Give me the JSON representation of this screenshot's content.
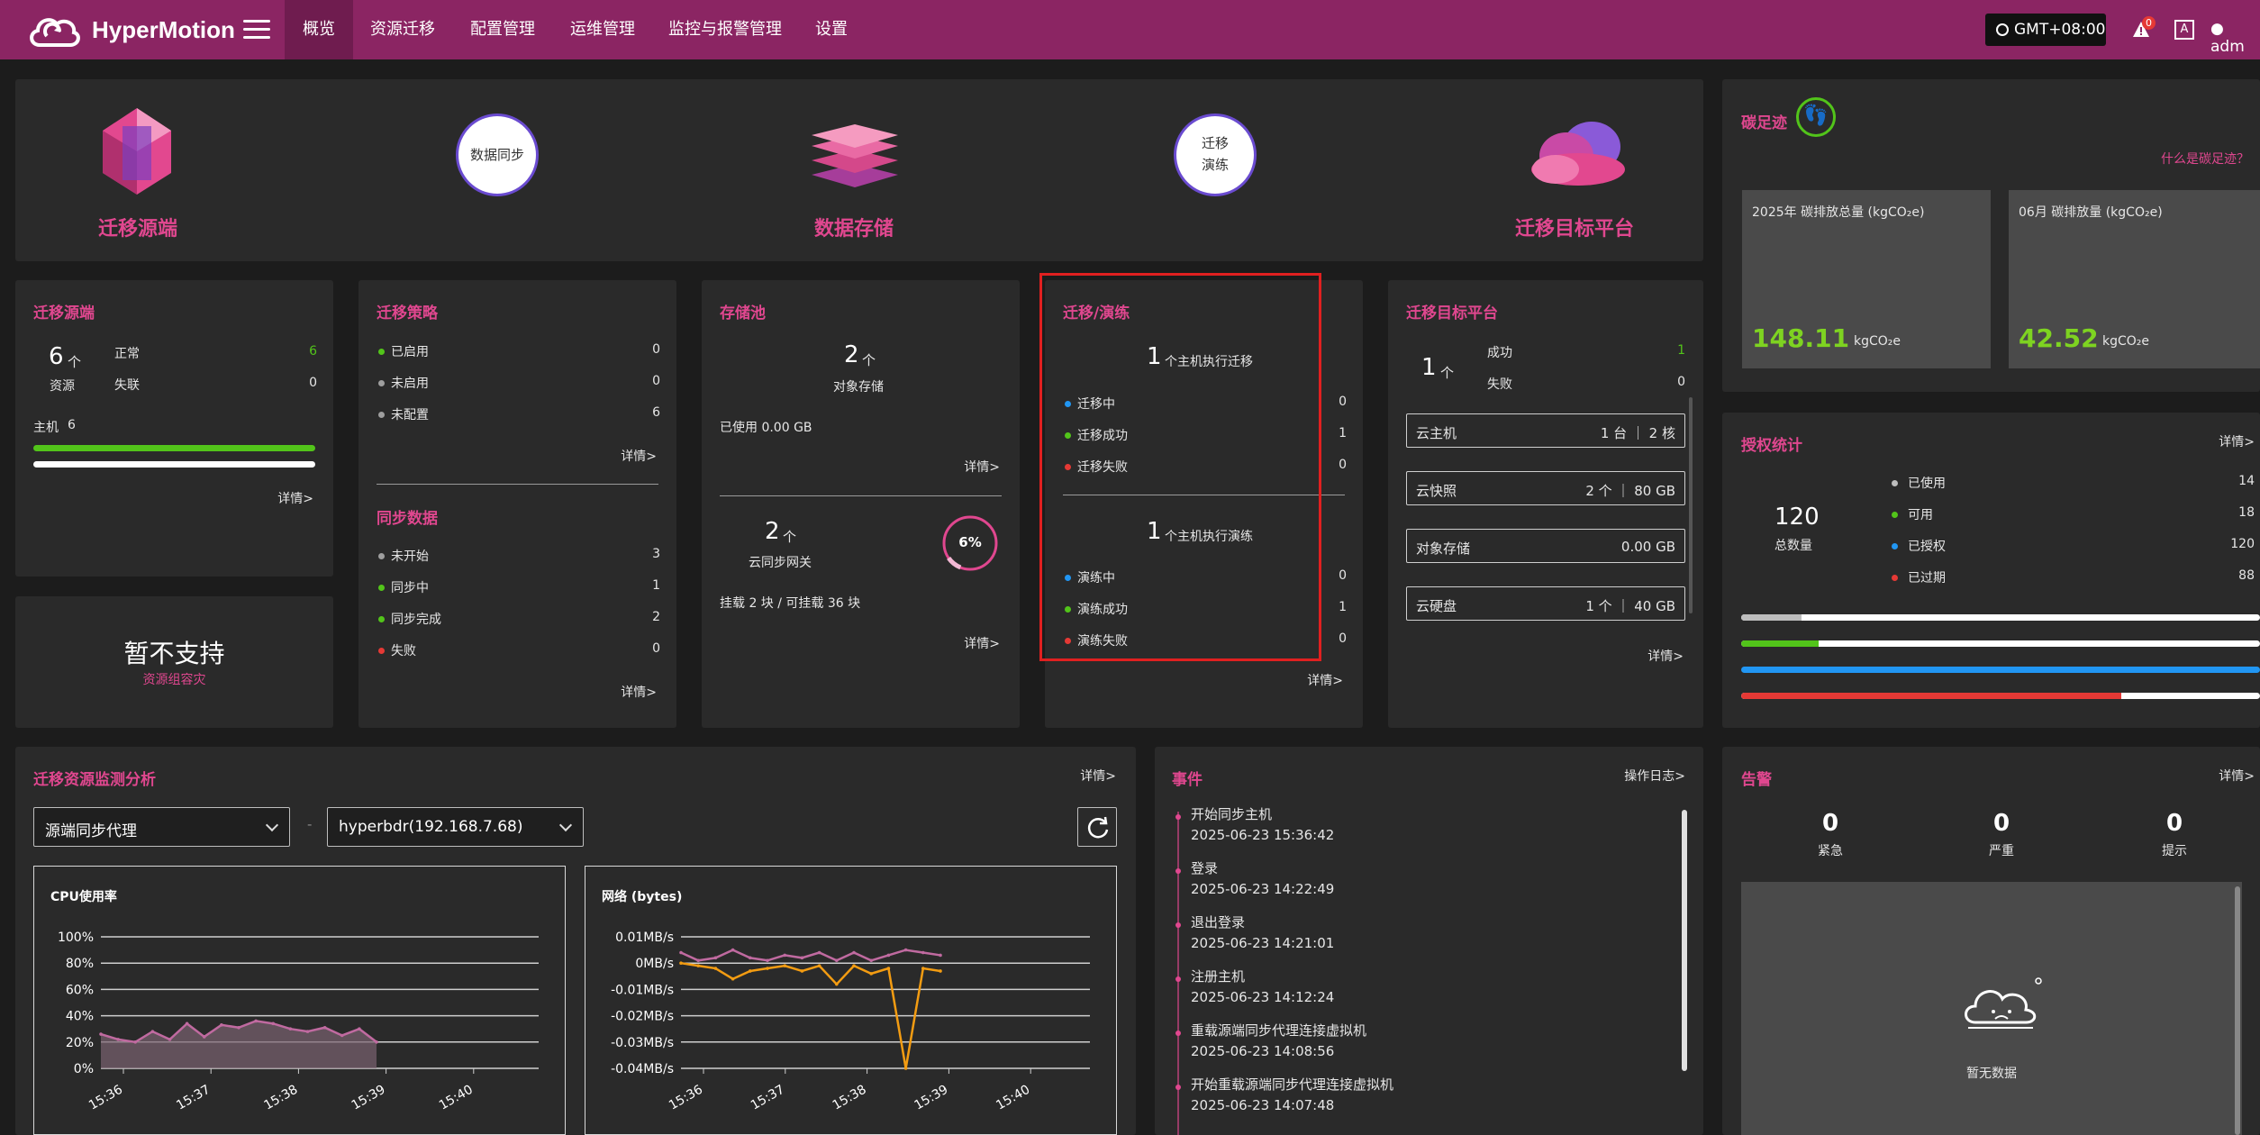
{
  "nav": {
    "brand": "HyperMotion",
    "items": [
      "概览",
      "资源迁移",
      "配置管理",
      "运维管理",
      "监控与报警管理",
      "设置"
    ],
    "timezone": "GMT+08:00",
    "alert_count": "0",
    "user": "adm"
  },
  "flow": {
    "source": "迁移源端",
    "sync": "数据同步",
    "storage": "数据存储",
    "drill": "迁移\n演练",
    "target": "迁移目标平台"
  },
  "source_panel": {
    "title": "迁移源端",
    "count": "6",
    "unit": "个",
    "label": "资源",
    "normal_label": "正常",
    "normal": "6",
    "lost_label": "失联",
    "lost": "0",
    "host_label": "主机",
    "host": "6",
    "detail": "详情>",
    "normal_fraction": 1.0
  },
  "unsupported": {
    "title": "暂不支持",
    "sub": "资源组容灾"
  },
  "policy": {
    "title": "迁移策略",
    "items": [
      {
        "label": "已启用",
        "value": "0",
        "color": "#52c41a"
      },
      {
        "label": "未启用",
        "value": "0",
        "color": "#9e9e9e"
      },
      {
        "label": "未配置",
        "value": "6",
        "color": "#9e9e9e"
      }
    ],
    "detail": "详情>"
  },
  "syncdata": {
    "title": "同步数据",
    "items": [
      {
        "label": "未开始",
        "value": "3",
        "color": "#9e9e9e"
      },
      {
        "label": "同步中",
        "value": "1",
        "color": "#52c41a"
      },
      {
        "label": "同步完成",
        "value": "2",
        "color": "#52c41a"
      },
      {
        "label": "失败",
        "value": "0",
        "color": "#e53935"
      }
    ],
    "detail": "详情>"
  },
  "pool": {
    "title": "存储池",
    "obj_count": "2",
    "unit": "个",
    "obj_label": "对象存储",
    "used": "已使用 0.00 GB",
    "detail1": "详情>",
    "gw_count": "2",
    "gw_label": "云同步网关",
    "percent": "6%",
    "percent_value": 6,
    "mount": "挂载 2 块 / 可挂载 36 块",
    "detail2": "详情>"
  },
  "migrate": {
    "title": "迁移/演练",
    "mig_count": "1",
    "mig_label": "个主机执行迁移",
    "mig_items": [
      {
        "label": "迁移中",
        "value": "0",
        "color": "#2196f3"
      },
      {
        "label": "迁移成功",
        "value": "1",
        "color": "#52c41a"
      },
      {
        "label": "迁移失败",
        "value": "0",
        "color": "#e53935"
      }
    ],
    "drill_count": "1",
    "drill_label": "个主机执行演练",
    "drill_items": [
      {
        "label": "演练中",
        "value": "0",
        "color": "#2196f3"
      },
      {
        "label": "演练成功",
        "value": "1",
        "color": "#52c41a"
      },
      {
        "label": "演练失败",
        "value": "0",
        "color": "#e53935"
      }
    ],
    "detail": "详情>"
  },
  "target": {
    "title": "迁移目标平台",
    "count": "1",
    "unit": "个",
    "ok_label": "成功",
    "ok": "1",
    "fail_label": "失败",
    "fail": "0",
    "boxes": [
      {
        "label": "云主机",
        "value": "1 台 ｜ 2 核"
      },
      {
        "label": "云快照",
        "value": "2 个 ｜ 80 GB"
      },
      {
        "label": "对象存储",
        "value": "0.00 GB"
      },
      {
        "label": "云硬盘",
        "value": "1 个 ｜ 40 GB"
      }
    ],
    "detail": "详情>"
  },
  "carbon": {
    "title": "碳足迹",
    "help": "什么是碳足迹？",
    "year_label": "2025年 碳排放总量 (kgCO₂e)",
    "year_value": "148.11",
    "month_label": "06月 碳排放量 (kgCO₂e)",
    "month_value": "42.52",
    "unit": "kgCO₂e"
  },
  "license": {
    "title": "授权统计",
    "detail": "详情>",
    "total": "120",
    "total_label": "总数量",
    "items": [
      {
        "label": "已使用",
        "value": "14",
        "color": "#bdbdbd",
        "fraction": 0.117
      },
      {
        "label": "可用",
        "value": "18",
        "color": "#52c41a",
        "fraction": 0.15
      },
      {
        "label": "已授权",
        "value": "120",
        "color": "#2196f3",
        "fraction": 1.0
      },
      {
        "label": "已过期",
        "value": "88",
        "color": "#e53935",
        "fraction": 0.733
      }
    ]
  },
  "monitor": {
    "title": "迁移资源监测分析",
    "detail": "详情>",
    "select1": "源端同步代理",
    "dash": "-",
    "select2": "hyperbdr(192.168.7.68)"
  },
  "events": {
    "title": "事件",
    "log": "操作日志>",
    "items": [
      {
        "title": "开始同步主机",
        "time": "2025-06-23 15:36:42"
      },
      {
        "title": "登录",
        "time": "2025-06-23 14:22:49"
      },
      {
        "title": "退出登录",
        "time": "2025-06-23 14:21:01"
      },
      {
        "title": "注册主机",
        "time": "2025-06-23 14:12:24"
      },
      {
        "title": "重载源端同步代理连接虚拟机",
        "time": "2025-06-23 14:08:56"
      },
      {
        "title": "开始重载源端同步代理连接虚拟机",
        "time": "2025-06-23 14:07:48"
      }
    ]
  },
  "alarm": {
    "title": "告警",
    "detail": "详情>",
    "items": [
      {
        "value": "0",
        "label": "紧急"
      },
      {
        "value": "0",
        "label": "严重"
      },
      {
        "value": "0",
        "label": "提示"
      }
    ],
    "empty": "暂无数据"
  },
  "chart_data": [
    {
      "type": "area",
      "title": "CPU使用率",
      "x": [
        "15:36",
        "15:37",
        "15:38",
        "15:39",
        "15:40"
      ],
      "y_ticks": [
        "100%",
        "80%",
        "60%",
        "40%",
        "20%",
        "0%"
      ],
      "ylim": [
        0,
        100
      ],
      "series": [
        {
          "values": [
            26,
            22,
            20,
            28,
            22,
            34,
            24,
            33,
            31,
            36,
            34,
            30,
            28,
            31,
            25,
            30,
            20
          ]
        }
      ]
    },
    {
      "type": "line",
      "title": "网络 (bytes)",
      "x": [
        "15:36",
        "15:37",
        "15:38",
        "15:39",
        "15:40"
      ],
      "y_ticks": [
        "0.01MB/s",
        "0MB/s",
        "-0.01MB/s",
        "-0.02MB/s",
        "-0.03MB/s",
        "-0.04MB/s"
      ],
      "ylim": [
        -0.04,
        0.01
      ],
      "series": [
        {
          "color": "#c06aa0",
          "values": [
            0.004,
            0.001,
            0.002,
            0.005,
            0.002,
            0.001,
            0.003,
            0.002,
            0.004,
            0.001,
            0.004,
            0.001,
            0.003,
            0.005,
            0.004,
            0.003
          ]
        },
        {
          "color": "#f39c12",
          "values": [
            0,
            -0.001,
            -0.002,
            -0.006,
            -0.003,
            -0.002,
            -0.001,
            -0.003,
            -0.001,
            -0.008,
            -0.001,
            -0.004,
            -0.002,
            -0.04,
            -0.002,
            -0.003
          ]
        }
      ]
    }
  ]
}
